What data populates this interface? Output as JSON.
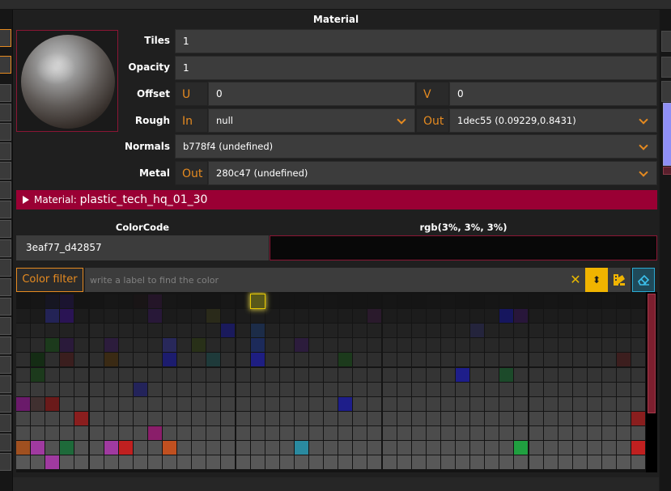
{
  "header": {
    "title": "Material"
  },
  "props": {
    "tiles": {
      "label": "Tiles",
      "value": "1"
    },
    "opacity": {
      "label": "Opacity",
      "value": "1"
    },
    "offset": {
      "label": "Offset",
      "u_label": "U",
      "u_value": "0",
      "v_label": "V",
      "v_value": "0"
    },
    "rough": {
      "label": "Rough",
      "in_label": "In",
      "in_value": "null",
      "out_label": "Out",
      "out_value": "1dec55 (0.09229,0.8431)"
    },
    "normals": {
      "label": "Normals",
      "value": "b778f4 (undefined)"
    },
    "metal": {
      "label": "Metal",
      "out_label": "Out",
      "value": "280c47 (undefined)"
    }
  },
  "material_bar": {
    "prefix": "Material:",
    "name": "plastic_tech_hq_01_30"
  },
  "color_code": {
    "header": "ColorCode",
    "value": "3eaf77_d42857",
    "rgb_header": "rgb(3%, 3%, 3%)",
    "swatch_color": "#080808"
  },
  "filter": {
    "button_label": "Color filter",
    "placeholder": "write a label to find the color",
    "clear_glyph": "✕",
    "sort_glyph": "⬍",
    "palette_icon": "palette-icon",
    "eraser_icon": "eraser-icon"
  },
  "accent_colors": {
    "orange": "#e58a20",
    "crimson": "#9a0034",
    "yellow": "#f0b400",
    "cyan": "#2aaad2"
  },
  "palette": {
    "columns": 43,
    "rows": 12,
    "selected": {
      "row": 0,
      "col": 16,
      "color": "#58581a"
    },
    "rows_colors": [
      [
        "#151515",
        "#161616",
        "#161622",
        "#1b1430",
        "#141414",
        "#151515",
        "#171717",
        "#161616",
        "#191516",
        "#241528",
        "#171717",
        "#161616",
        "#151515",
        "#151515",
        "#171717",
        "#161616",
        "#58581a",
        "#151515",
        "#151515",
        "#151515",
        "#161616",
        "#161616",
        "#151515",
        "#151515",
        "#151515",
        "#161616",
        "#151515",
        "#151515",
        "#161616",
        "#161616",
        "#151515",
        "#151515",
        "#161616",
        "#161616",
        "#151515",
        "#151515",
        "#161616",
        "#151515",
        "#161616",
        "#151515",
        "#161616",
        "#151515",
        "#151515"
      ],
      [
        "#1c1c1c",
        "#1b1b1b",
        "#232356",
        "#2a1454",
        "#1c1c1c",
        "#1c1c1c",
        "#1d1d1d",
        "#1c1c1c",
        "#1c1c1c",
        "#281838",
        "#1b1b1b",
        "#1c1c1c",
        "#1d1d1d",
        "#2a2a1a",
        "#1c1c1c",
        "#1c1c1c",
        "#1c1c1c",
        "#1b1b1b",
        "#1c1c1c",
        "#1c1c1c",
        "#1c1c1c",
        "#1c1c1c",
        "#1c1c1c",
        "#1c1c1c",
        "#2a1a2c",
        "#1c1c1c",
        "#1c1c1c",
        "#1c1c1c",
        "#1c1c1c",
        "#1c1c1c",
        "#1c1c1c",
        "#1c1c1c",
        "#1c1c1c",
        "#16165e",
        "#28163a",
        "#1c1c1c",
        "#1c1c1c",
        "#1c1c1c",
        "#1c1c1c",
        "#1c1c1c",
        "#1c1c1c",
        "#1c1c1c",
        "#1c1c1c"
      ],
      [
        "#222222",
        "#232323",
        "#222222",
        "#222222",
        "#222222",
        "#242424",
        "#232323",
        "#232323",
        "#222222",
        "#222222",
        "#222222",
        "#232323",
        "#222222",
        "#222222",
        "#1a1a5c",
        "#222222",
        "#1c2c48",
        "#222222",
        "#222222",
        "#222222",
        "#232323",
        "#222222",
        "#222222",
        "#222222",
        "#222222",
        "#222222",
        "#222222",
        "#222222",
        "#222222",
        "#222222",
        "#222222",
        "#24243c",
        "#222222",
        "#222222",
        "#222222",
        "#222222",
        "#222222",
        "#222222",
        "#222222",
        "#222222",
        "#222222",
        "#222222",
        "#222222"
      ],
      [
        "#282828",
        "#2a2a2a",
        "#1c3a1c",
        "#2a1a3a",
        "#282828",
        "#282828",
        "#2c1c3c",
        "#282828",
        "#282828",
        "#282828",
        "#28285a",
        "#282828",
        "#283018",
        "#282828",
        "#282828",
        "#282828",
        "#1c2a5a",
        "#282828",
        "#282828",
        "#2c1c3c",
        "#282828",
        "#282828",
        "#282828",
        "#282828",
        "#282828",
        "#282828",
        "#282828",
        "#282828",
        "#282828",
        "#282828",
        "#282828",
        "#282828",
        "#282828",
        "#282828",
        "#282828",
        "#282828",
        "#282828",
        "#282828",
        "#282828",
        "#282828",
        "#282828",
        "#282828",
        "#282828"
      ],
      [
        "#2e2e2e",
        "#142c14",
        "#2e2e2e",
        "#3a1e1e",
        "#2e2e2e",
        "#2e2e2e",
        "#3a2a14",
        "#2e2e2e",
        "#2e2e2e",
        "#2e2e2e",
        "#1c1c6e",
        "#2e2e2e",
        "#2e2e2e",
        "#1e3a3a",
        "#2e2e2e",
        "#2e2e2e",
        "#1e1e82",
        "#2e2e2e",
        "#2e2e2e",
        "#2e2e2e",
        "#2e2e2e",
        "#2e2e2e",
        "#1c3a1c",
        "#2e2e2e",
        "#2e2e2e",
        "#2e2e2e",
        "#2e2e2e",
        "#2e2e2e",
        "#2e2e2e",
        "#2e2e2e",
        "#2e2e2e",
        "#2e2e2e",
        "#2e2e2e",
        "#2e2e2e",
        "#2e2e2e",
        "#2e2e2e",
        "#2e2e2e",
        "#2e2e2e",
        "#2e2e2e",
        "#2e2e2e",
        "#2e2e2e",
        "#3c1e1e",
        "#2e2e2e"
      ],
      [
        "#343434",
        "#1c3a1c",
        "#343434",
        "#343434",
        "#343434",
        "#343434",
        "#343434",
        "#343434",
        "#343434",
        "#343434",
        "#343434",
        "#343434",
        "#343434",
        "#343434",
        "#343434",
        "#343434",
        "#343434",
        "#343434",
        "#343434",
        "#343434",
        "#343434",
        "#343434",
        "#343434",
        "#343434",
        "#343434",
        "#343434",
        "#343434",
        "#343434",
        "#343434",
        "#343434",
        "#1e1e8a",
        "#343434",
        "#343434",
        "#1c4a2a",
        "#343434",
        "#343434",
        "#343434",
        "#343434",
        "#343434",
        "#343434",
        "#343434",
        "#343434",
        "#343434"
      ],
      [
        "#3a3a3a",
        "#3a3a3a",
        "#3a3a3a",
        "#3a3a3a",
        "#3a3a3a",
        "#3a3a3a",
        "#3a3a3a",
        "#3a3a3a",
        "#23235a",
        "#3a3a3a",
        "#3a3a3a",
        "#3a3a3a",
        "#3a3a3a",
        "#3a3a3a",
        "#3a3a3a",
        "#3a3a3a",
        "#3a3a3a",
        "#3a3a3a",
        "#3a3a3a",
        "#3a3a3a",
        "#3a3a3a",
        "#3a3a3a",
        "#3a3a3a",
        "#3a3a3a",
        "#3a3a3a",
        "#3a3a3a",
        "#3a3a3a",
        "#3a3a3a",
        "#3a3a3a",
        "#3a3a3a",
        "#3a3a3a",
        "#3a3a3a",
        "#3a3a3a",
        "#3a3a3a",
        "#3a3a3a",
        "#3a3a3a",
        "#3a3a3a",
        "#3a3a3a",
        "#3a3a3a",
        "#3a3a3a",
        "#3a3a3a",
        "#3a3a3a",
        "#3a3a3a"
      ],
      [
        "#6a1a6a",
        "#403030",
        "#6a1a1a",
        "#404040",
        "#404040",
        "#404040",
        "#404040",
        "#404040",
        "#404040",
        "#404040",
        "#404040",
        "#404040",
        "#404040",
        "#404040",
        "#404040",
        "#404040",
        "#404040",
        "#404040",
        "#404040",
        "#404040",
        "#404040",
        "#404040",
        "#1e1e8a",
        "#404040",
        "#404040",
        "#404040",
        "#404040",
        "#404040",
        "#404040",
        "#404040",
        "#404040",
        "#404040",
        "#404040",
        "#404040",
        "#404040",
        "#404040",
        "#404040",
        "#404040",
        "#404040",
        "#404040",
        "#404040",
        "#404040",
        "#404040"
      ],
      [
        "#464646",
        "#464646",
        "#464646",
        "#464646",
        "#8a1e1e",
        "#464646",
        "#464646",
        "#464646",
        "#464646",
        "#464646",
        "#464646",
        "#464646",
        "#464646",
        "#464646",
        "#464646",
        "#464646",
        "#464646",
        "#464646",
        "#464646",
        "#464646",
        "#464646",
        "#464646",
        "#464646",
        "#464646",
        "#464646",
        "#464646",
        "#464646",
        "#464646",
        "#464646",
        "#464646",
        "#464646",
        "#464646",
        "#464646",
        "#464646",
        "#464646",
        "#464646",
        "#464646",
        "#464646",
        "#464646",
        "#464646",
        "#464646",
        "#464646",
        "#8a1e1e"
      ],
      [
        "#4c4c4c",
        "#4c4c4c",
        "#4c4c4c",
        "#4c4c4c",
        "#4c4c4c",
        "#4c4c4c",
        "#4c4c4c",
        "#4c4c4c",
        "#4c4c4c",
        "#8a1e6a",
        "#4c4c4c",
        "#4c4c4c",
        "#4c4c4c",
        "#4c4c4c",
        "#4c4c4c",
        "#4c4c4c",
        "#4c4c4c",
        "#4c4c4c",
        "#4c4c4c",
        "#4c4c4c",
        "#4c4c4c",
        "#4c4c4c",
        "#4c4c4c",
        "#4c4c4c",
        "#4c4c4c",
        "#4c4c4c",
        "#4c4c4c",
        "#4c4c4c",
        "#4c4c4c",
        "#4c4c4c",
        "#4c4c4c",
        "#4c4c4c",
        "#4c4c4c",
        "#4c4c4c",
        "#4c4c4c",
        "#4c4c4c",
        "#4c4c4c",
        "#4c4c4c",
        "#4c4c4c",
        "#4c4c4c",
        "#4c4c4c",
        "#4c4c4c",
        "#4c4c4c"
      ],
      [
        "#a05020",
        "#a03aa0",
        "#525252",
        "#1e6a3a",
        "#525252",
        "#525252",
        "#a03aa0",
        "#c02020",
        "#525252",
        "#525252",
        "#c05020",
        "#525252",
        "#525252",
        "#525252",
        "#525252",
        "#525252",
        "#525252",
        "#525252",
        "#525252",
        "#2a8aa0",
        "#525252",
        "#525252",
        "#525252",
        "#525252",
        "#525252",
        "#525252",
        "#525252",
        "#525252",
        "#525252",
        "#525252",
        "#525252",
        "#525252",
        "#525252",
        "#525252",
        "#20a040",
        "#525252",
        "#525252",
        "#525252",
        "#525252",
        "#525252",
        "#525252",
        "#525252",
        "#c02020"
      ],
      [
        "#585858",
        "#585858",
        "#a03aa0",
        "#585858",
        "#585858",
        "#585858",
        "#585858",
        "#585858",
        "#585858",
        "#585858",
        "#585858",
        "#585858",
        "#585858",
        "#585858",
        "#585858",
        "#585858",
        "#585858",
        "#585858",
        "#585858",
        "#585858",
        "#585858",
        "#585858",
        "#585858",
        "#585858",
        "#585858",
        "#585858",
        "#585858",
        "#585858",
        "#585858",
        "#585858",
        "#585858",
        "#585858",
        "#585858",
        "#585858",
        "#585858",
        "#585858",
        "#585858",
        "#585858",
        "#585858",
        "#585858",
        "#585858",
        "#585858",
        "#585858"
      ]
    ]
  }
}
